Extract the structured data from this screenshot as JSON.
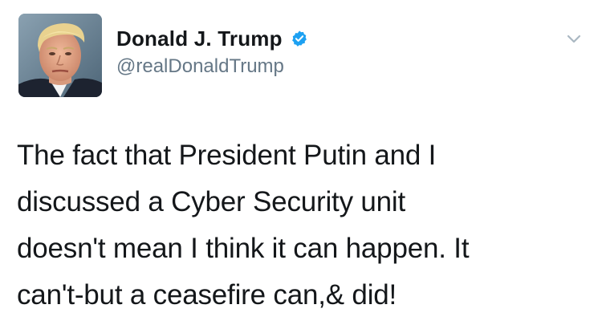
{
  "author": {
    "display_name": "Donald J. Trump",
    "handle": "@realDonaldTrump",
    "verified": true
  },
  "icons": {
    "verified": "verified-badge-icon",
    "menu": "chevron-down-icon"
  },
  "colors": {
    "verified_blue": "#1da1f2",
    "handle_gray": "#657786",
    "text": "#14171a",
    "chevron_gray": "#aab8c2"
  },
  "tweet": {
    "lines": [
      "The fact that President Putin and I",
      "discussed a Cyber Security unit",
      "doesn't mean I think it can happen. It",
      "can't-but a ceasefire can,& did!"
    ]
  }
}
